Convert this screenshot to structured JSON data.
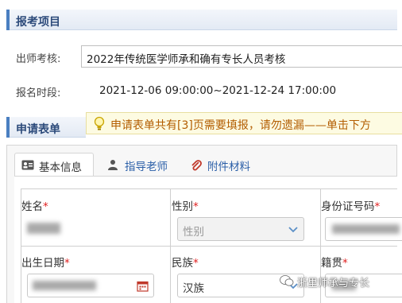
{
  "registration_section": {
    "title": "报考项目",
    "exam_label": "出师考核:",
    "exam_value": "2022年传统医学师承和确有专长人员考核",
    "period_label": "报名时段:",
    "period_value": "2021-12-06 09:00:00~2021-12-24 17:00:00"
  },
  "application_section": {
    "title": "申请表单",
    "notice": "申请表单共有[3]页需要填报，请勿遗漏——单击下方"
  },
  "tabs": [
    {
      "label": "基本信息",
      "icon": "id-card-icon",
      "active": true
    },
    {
      "label": "指导老师",
      "icon": "user-icon",
      "active": false
    },
    {
      "label": "附件材料",
      "icon": "paperclip-icon",
      "active": false
    }
  ],
  "form": {
    "name_label": "姓名",
    "gender_label": "性别",
    "gender_placeholder": "性别",
    "id_label": "身份证号码",
    "birth_label": "出生日期",
    "ethnicity_label": "民族",
    "ethnicity_value": "汉族",
    "native_label": "籍贯",
    "required_mark": "*"
  },
  "watermark": "浙里师承与专长",
  "colors": {
    "header_text": "#2c4a7a",
    "notice_text": "#b35d00",
    "required": "#e02020",
    "tab_link": "#2b5fa8"
  }
}
